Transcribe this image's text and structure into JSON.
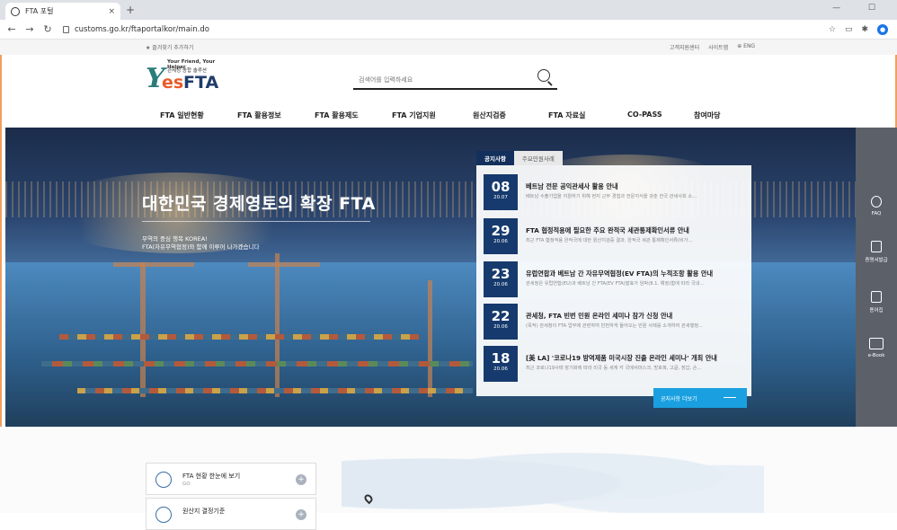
{
  "browser": {
    "tab_title": "FTA 포털",
    "tab_close": "×",
    "new_tab": "+",
    "window_controls": "— ☐",
    "url": "customs.go.kr/ftaportalkor/main.do"
  },
  "utility": {
    "bookmark": "★ 즐겨찾기 추가하기",
    "links": [
      "고객지원센터",
      "사이트맵",
      "⊕ ENG"
    ]
  },
  "logo": {
    "tagline1": "Your Friend, Your Helper",
    "tagline2": "관세청 종합 솔루션",
    "y": "Y",
    "es": "es",
    "fta": "FTA"
  },
  "search": {
    "placeholder": "검색어를 입력하세요"
  },
  "gnb": [
    "FTA 일반현황",
    "FTA 활용정보",
    "FTA 활용제도",
    "FTA 기업지원",
    "원산지검증",
    "FTA 자료실",
    "CO-PASS",
    "참여마당"
  ],
  "hero": {
    "title": "대한민국 경제영토의 확장 FTA",
    "sub1": "무역의 중심 행복 KOREA!",
    "sub2": "FTA(자유무역협정)와 함께 이루어 나가겠습니다"
  },
  "notice": {
    "tabs": [
      "공지사항",
      "주요민원사례"
    ],
    "items": [
      {
        "day": "08",
        "month": "20.07",
        "title": "베트남 전문 공익관세사 활용 안내",
        "desc": "베트남 수출기업을 지원하기 위해 현지 근무 경험과 전문지식을 갖춘 한국 관세사회 소..."
      },
      {
        "day": "29",
        "month": "20.06",
        "title": "FTA 협정적용에 필요한 주요 완적국 세관통제확인서류 안내",
        "desc": "최근 FTA 협정적용 완적국에 대한 원산지검증 결과, 완적국 세관 통제확인서류(비가..."
      },
      {
        "day": "23",
        "month": "20.06",
        "title": "유럽연합과 베트남 간 자유무역협정(EV FTA)의 누적조항 활용 안내",
        "desc": "관세청은 유럽연합(EU)과 베트남 간 FTA(EV FTA)발효가 임박(8.1. 예정)함에 따라 국내..."
      },
      {
        "day": "22",
        "month": "20.06",
        "title": "관세청, FTA 빈번 민원 온라인 세미나 참가 신청 안내",
        "desc": "(목적) 관세청이 FTA 업무에 관련하여 빈번하게 들어오는 민원 사례를 소개하여 관세행정..."
      },
      {
        "day": "18",
        "month": "20.06",
        "title": "[美 LA] '코로나19 방역제품 미국시장 진출 온라인 세미나' 개최 안내",
        "desc": "최근 코로나19사태 장기화에 따라 미국 등 세계 각 국에서마스크, 방호복, 고글, 장갑, 손..."
      }
    ],
    "more": "공지사항 더보기"
  },
  "quick": [
    "FAQ",
    "증명서발급",
    "용어집",
    "e-Book"
  ],
  "cards": [
    {
      "title": "FTA 현황 한눈에 보기",
      "sub": "GO"
    },
    {
      "title": "원산지 결정기준",
      "sub": ""
    }
  ]
}
